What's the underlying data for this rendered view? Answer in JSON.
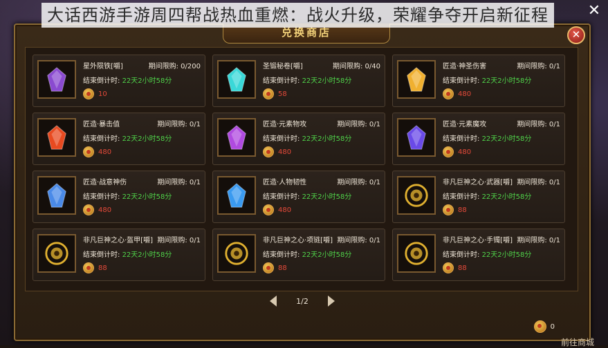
{
  "caption": "大话西游手游周四帮战热血重燃：战火升级，荣耀争夺开启新征程",
  "window": {
    "title": "兑换商店"
  },
  "labels": {
    "limit_prefix": "期间限购:",
    "countdown_label": "结束倒计时:"
  },
  "items": [
    {
      "name": "星外陨铁[嚼]",
      "limit": "0/200",
      "countdown": "22天2小时58分",
      "price": "10",
      "icon": "purple-ore-icon",
      "color": "#8a4ad0"
    },
    {
      "name": "圣锻秘卷[嚼]",
      "limit": "0/40",
      "countdown": "22天2小时58分",
      "price": "58",
      "icon": "cyan-scroll-icon",
      "color": "#3ad8d8"
    },
    {
      "name": "匠造·神圣伤害",
      "limit": "0/1",
      "countdown": "22天2小时58分",
      "price": "480",
      "icon": "gold-crystal-icon",
      "color": "#f0b030"
    },
    {
      "name": "匠造·暴击值",
      "limit": "0/1",
      "countdown": "22天2小时58分",
      "price": "480",
      "icon": "red-crystal-icon",
      "color": "#e84a20"
    },
    {
      "name": "匠造·元素物攻",
      "limit": "0/1",
      "countdown": "22天2小时58分",
      "price": "480",
      "icon": "violet-crystal-icon",
      "color": "#b04ae0"
    },
    {
      "name": "匠造·元素魔攻",
      "limit": "0/1",
      "countdown": "22天2小时58分",
      "price": "480",
      "icon": "blue-violet-crystal-icon",
      "color": "#6a4ae8"
    },
    {
      "name": "匠造·战意神伤",
      "limit": "0/1",
      "countdown": "22天2小时58分",
      "price": "480",
      "icon": "red-blue-crystal-icon",
      "color": "#4a8ae8"
    },
    {
      "name": "匠造·人物韧性",
      "limit": "0/1",
      "countdown": "22天2小时58分",
      "price": "480",
      "icon": "blue-gem-icon",
      "color": "#3a9af0"
    },
    {
      "name": "非凡巨神之心·武器[嚼]",
      "limit": "0/1",
      "countdown": "22天2小时58分",
      "price": "88",
      "icon": "golden-emblem-icon",
      "color": "#e0b030"
    },
    {
      "name": "非凡巨神之心·盔甲[嚼]",
      "limit": "0/1",
      "countdown": "22天2小时58分",
      "price": "88",
      "icon": "golden-emblem-icon",
      "color": "#e0b030"
    },
    {
      "name": "非凡巨神之心·项链[嚼]",
      "limit": "0/1",
      "countdown": "22天2小时58分",
      "price": "88",
      "icon": "golden-emblem-icon",
      "color": "#e0b030"
    },
    {
      "name": "非凡巨神之心·手镯[嚼]",
      "limit": "0/1",
      "countdown": "22天2小时58分",
      "price": "88",
      "icon": "golden-emblem-icon",
      "color": "#e0b030"
    }
  ],
  "pager": {
    "page": "1/2"
  },
  "balance": {
    "value": "0"
  },
  "footer": {
    "shop_link": "前往商城"
  },
  "close_glyph": "✕"
}
